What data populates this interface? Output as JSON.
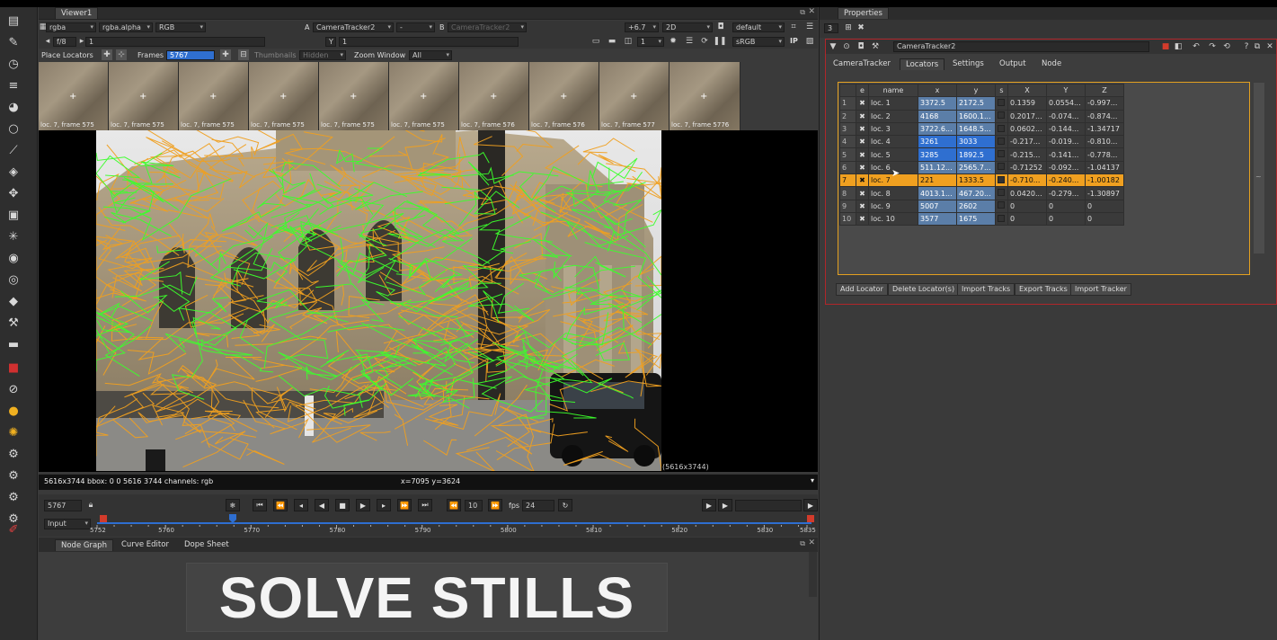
{
  "viewer": {
    "tab_title": "Viewer1",
    "channels": "rgba",
    "alpha": "rgba.alpha",
    "display": "RGB",
    "input_a_label": "A",
    "input_a": "CameraTracker2",
    "input_a_op": "-",
    "input_b_label": "B",
    "input_b": "CameraTracker2",
    "gain": "+6.7",
    "view_mode": "2D",
    "lut": "default",
    "fstop": "f/8",
    "frame_field": "1",
    "y_label": "Y",
    "y_value": "1",
    "proxy": "1",
    "colorspace": "sRGB",
    "ip_label": "IP",
    "place_locators": "Place Locators",
    "frames_label": "Frames",
    "frames_value": "5767",
    "thumbnails_label": "Thumbnails",
    "thumbnails_value": "Hidden",
    "zoom_window_label": "Zoom Window",
    "zoom_window_value": "All",
    "format_label": "(5616x3744)",
    "info_left": "5616x3744 bbox: 0 0 5616 3744 channels: rgb",
    "info_coords": "x=7095 y=3624"
  },
  "filmstrip": [
    {
      "caption": "loc. 7, frame 575"
    },
    {
      "caption": "loc. 7, frame 575"
    },
    {
      "caption": "loc. 7, frame 575"
    },
    {
      "caption": "loc. 7, frame 575"
    },
    {
      "caption": "loc. 7, frame 575"
    },
    {
      "caption": "loc. 7, frame 575"
    },
    {
      "caption": "loc. 7, frame 576"
    },
    {
      "caption": "loc. 7, frame 576"
    },
    {
      "caption": "loc. 7, frame 577"
    },
    {
      "caption": "loc. 7, frame 5776"
    }
  ],
  "transport": {
    "current_frame": "5767",
    "step": "10",
    "fps_label": "fps",
    "fps_value": "24",
    "input_mode": "Input",
    "ticks": [
      "5752",
      "5760",
      "5770",
      "5780",
      "5790",
      "5800",
      "5810",
      "5820",
      "5830",
      "5835"
    ]
  },
  "bottom_tabs": [
    "Node Graph",
    "Curve Editor",
    "Dope Sheet"
  ],
  "title_card": "SOLVE STILLS",
  "properties": {
    "tab_title": "Properties",
    "count": "3",
    "node_name": "CameraTracker2",
    "tabs": [
      "CameraTracker",
      "Locators",
      "Settings",
      "Output",
      "Node"
    ],
    "active_tab": "Locators",
    "columns": [
      "",
      "e",
      "name",
      "x",
      "y",
      "s",
      "X",
      "Y",
      "Z"
    ],
    "rows": [
      {
        "n": "1",
        "name": "loc. 1",
        "x": "3372.5",
        "y": "2172.5",
        "X": "0.1359",
        "Y": "0.0554...",
        "Z": "-0.997..."
      },
      {
        "n": "2",
        "name": "loc. 2",
        "x": "4168",
        "y": "1600.1...",
        "X": "0.2017...",
        "Y": "-0.074...",
        "Z": "-0.874..."
      },
      {
        "n": "3",
        "name": "loc. 3",
        "x": "3722.6...",
        "y": "1648.5...",
        "X": "0.0602...",
        "Y": "-0.144...",
        "Z": "-1.34717"
      },
      {
        "n": "4",
        "name": "loc. 4",
        "x": "3261",
        "y": "3033",
        "X": "-0.217...",
        "Y": "-0.019...",
        "Z": "-0.810..."
      },
      {
        "n": "5",
        "name": "loc. 5",
        "x": "3285",
        "y": "1892.5",
        "X": "-0.215...",
        "Y": "-0.141...",
        "Z": "-0.778..."
      },
      {
        "n": "6",
        "name": "loc. 6",
        "x": "511.12...",
        "y": "2565.7...",
        "X": "-0.71252",
        "Y": "-0.092...",
        "Z": "-1.04137"
      },
      {
        "n": "7",
        "name": "loc. 7",
        "x": "221",
        "y": "1333.5",
        "X": "-0.710...",
        "Y": "-0.240...",
        "Z": "-1.00182"
      },
      {
        "n": "8",
        "name": "loc. 8",
        "x": "4013.1...",
        "y": "467.20...",
        "X": "0.0420...",
        "Y": "-0.279...",
        "Z": "-1.30897"
      },
      {
        "n": "9",
        "name": "loc. 9",
        "x": "5007",
        "y": "2602",
        "X": "0",
        "Y": "0",
        "Z": "0"
      },
      {
        "n": "10",
        "name": "loc. 10",
        "x": "3577",
        "y": "1675",
        "X": "0",
        "Y": "0",
        "Z": "0"
      }
    ],
    "selected_row": 6,
    "buttons": [
      "Add Locator",
      "Delete Locator(s)",
      "Import Tracks",
      "Export Tracks",
      "Import Tracker"
    ]
  },
  "colors": {
    "accent_orange": "#f0a020",
    "panel_border_red": "#b0262a",
    "track_green": "#3cff2c",
    "track_orange": "#f0a020"
  }
}
